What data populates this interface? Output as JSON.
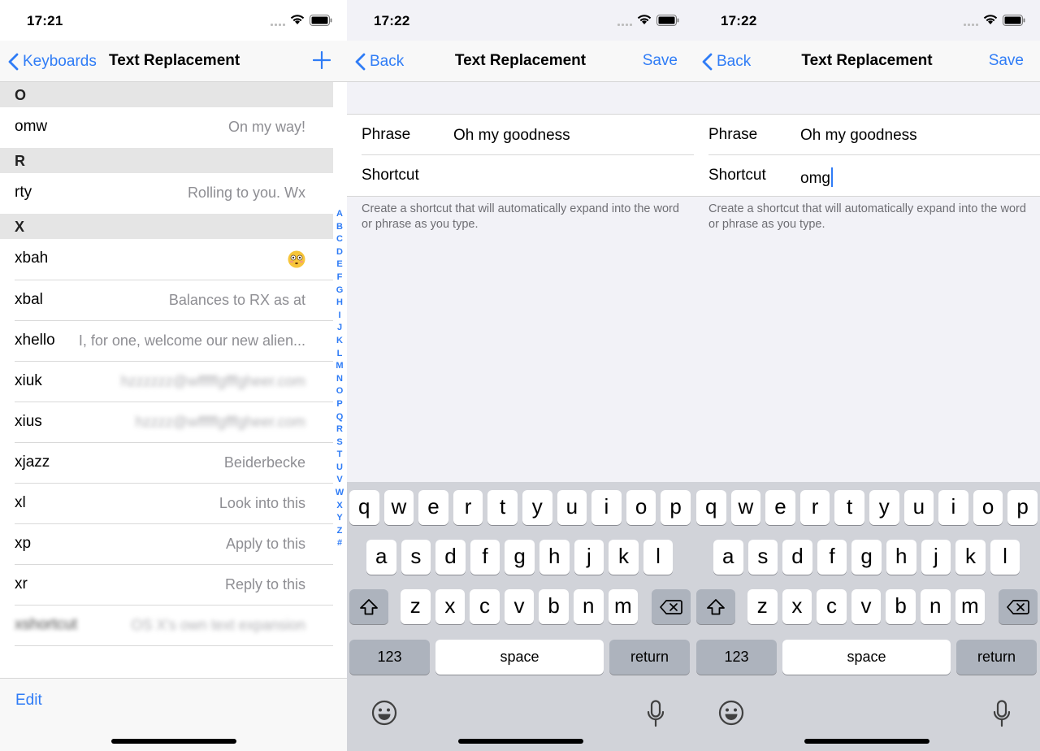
{
  "panel1": {
    "time": "17:21",
    "back_label": "Keyboards",
    "title": "Text Replacement",
    "sections": [
      {
        "letter": "O",
        "rows": [
          {
            "shortcut": "omw",
            "phrase": "On my way!"
          }
        ]
      },
      {
        "letter": "R",
        "rows": [
          {
            "shortcut": "rty",
            "phrase": "Rolling to you. Wx"
          }
        ]
      },
      {
        "letter": "X",
        "rows": [
          {
            "shortcut": "xbah",
            "phrase": "😳"
          },
          {
            "shortcut": "xbal",
            "phrase": "Balances to RX as at"
          },
          {
            "shortcut": "xhello",
            "phrase": "I, for one, welcome our new alien..."
          },
          {
            "shortcut": "xiuk",
            "phrase": "(blurred)"
          },
          {
            "shortcut": "xius",
            "phrase": "(blurred)"
          },
          {
            "shortcut": "xjazz",
            "phrase": "Beiderbecke"
          },
          {
            "shortcut": "xl",
            "phrase": "Look into this"
          },
          {
            "shortcut": "xp",
            "phrase": "Apply to this"
          },
          {
            "shortcut": "xr",
            "phrase": "Reply to this"
          },
          {
            "shortcut": "xshortcut",
            "phrase": "OS X's own text expansion"
          }
        ]
      }
    ],
    "index_letters": [
      "A",
      "B",
      "C",
      "D",
      "E",
      "F",
      "G",
      "H",
      "I",
      "J",
      "K",
      "L",
      "M",
      "N",
      "O",
      "P",
      "Q",
      "R",
      "S",
      "T",
      "U",
      "V",
      "W",
      "X",
      "Y",
      "Z",
      "#"
    ],
    "edit_label": "Edit"
  },
  "panel2": {
    "time": "17:22",
    "back_label": "Back",
    "title": "Text Replacement",
    "save_label": "Save",
    "phrase_label": "Phrase",
    "phrase_value": "Oh my goodness",
    "shortcut_label": "Shortcut",
    "shortcut_value": "",
    "footnote": "Create a shortcut that will automatically expand into the word or phrase as you type."
  },
  "panel3": {
    "time": "17:22",
    "back_label": "Back",
    "title": "Text Replacement",
    "save_label": "Save",
    "phrase_label": "Phrase",
    "phrase_value": "Oh my goodness",
    "shortcut_label": "Shortcut",
    "shortcut_value": "omg",
    "footnote": "Create a shortcut that will automatically expand into the word or phrase as you type."
  },
  "keyboard": {
    "row1": [
      "q",
      "w",
      "e",
      "r",
      "t",
      "y",
      "u",
      "i",
      "o",
      "p"
    ],
    "row2": [
      "a",
      "s",
      "d",
      "f",
      "g",
      "h",
      "j",
      "k",
      "l"
    ],
    "row3": [
      "z",
      "x",
      "c",
      "v",
      "b",
      "n",
      "m"
    ],
    "numbers_label": "123",
    "space_label": "space",
    "return_label": "return"
  },
  "colors": {
    "accent": "#2f7cf6",
    "keyboard_bg": "#d1d3d9",
    "fn_key": "#adb3bd"
  },
  "icons": [
    "wifi-icon",
    "battery-icon",
    "signal-icon",
    "chevron-left-icon",
    "plus-icon",
    "shift-icon",
    "delete-icon",
    "emoji-icon",
    "microphone-icon"
  ]
}
